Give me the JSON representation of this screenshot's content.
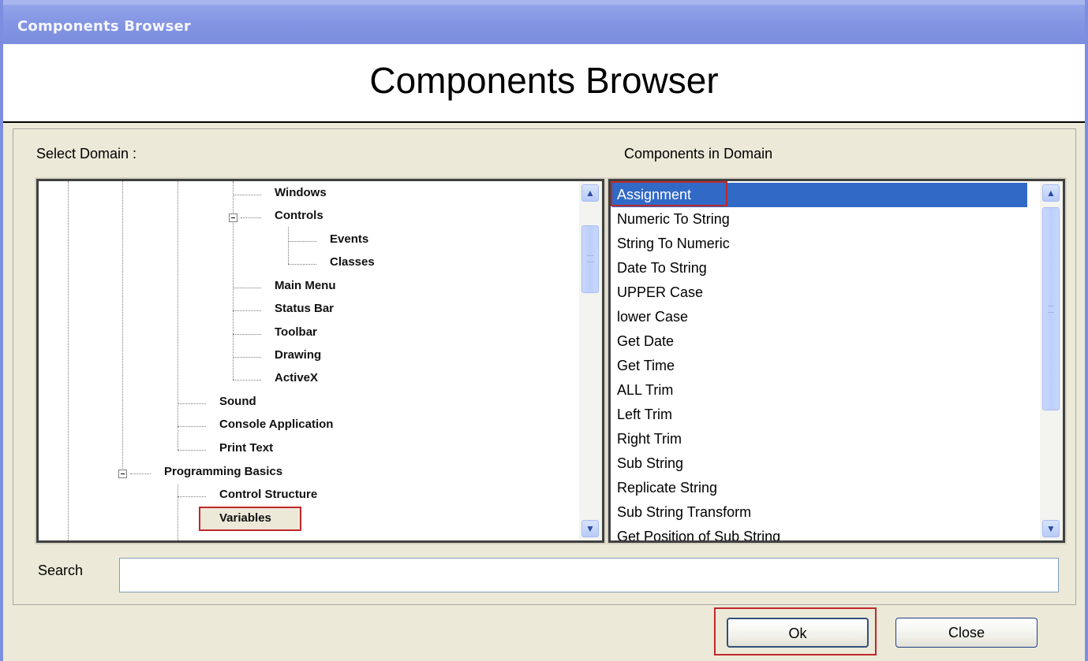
{
  "window": {
    "title": "Components Browser"
  },
  "header": {
    "title": "Components Browser"
  },
  "labels": {
    "select_domain": "Select Domain :",
    "components_in_domain": "Components in Domain",
    "search": "Search"
  },
  "tree": {
    "nodes": [
      {
        "label": "Windows"
      },
      {
        "label": "Controls",
        "expanded": true
      },
      {
        "label": "Events"
      },
      {
        "label": "Classes"
      },
      {
        "label": "Main Menu"
      },
      {
        "label": "Status Bar"
      },
      {
        "label": "Toolbar"
      },
      {
        "label": "Drawing"
      },
      {
        "label": "ActiveX"
      },
      {
        "label": "Sound"
      },
      {
        "label": "Console Application"
      },
      {
        "label": "Print Text"
      },
      {
        "label": "Programming Basics",
        "expanded": true
      },
      {
        "label": "Control Structure"
      },
      {
        "label": "Variables",
        "selected": true
      }
    ]
  },
  "components": {
    "items": [
      "Assignment",
      "Numeric To String",
      "String To Numeric",
      "Date To String",
      "UPPER Case",
      "lower Case",
      "Get Date",
      "Get Time",
      "ALL Trim",
      "Left Trim",
      "Right Trim",
      "Sub String",
      "Replicate String",
      "Sub String Transform",
      "Get Position of Sub String"
    ],
    "selected_index": 0
  },
  "search": {
    "value": ""
  },
  "buttons": {
    "ok": "Ok",
    "close": "Close"
  },
  "colors": {
    "title_bar": "#8294e2",
    "selection": "#3169c6",
    "highlight_box": "#c0282a",
    "dialog_bg": "#ece9d8"
  },
  "icons": {
    "scroll_up": "chevron-up-icon",
    "scroll_down": "chevron-down-icon",
    "tree_collapse": "minus-box-icon"
  }
}
